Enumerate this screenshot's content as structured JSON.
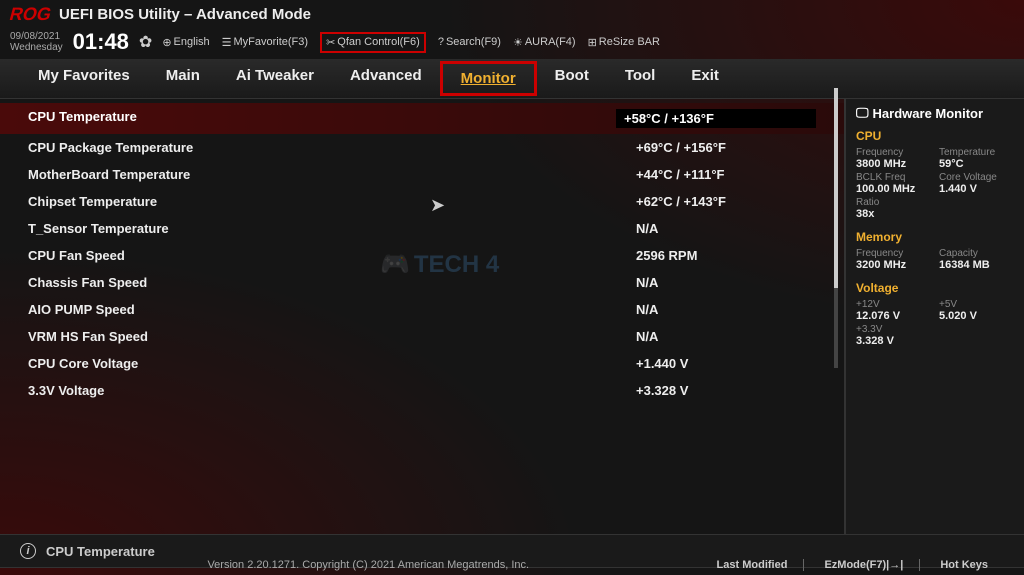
{
  "header": {
    "logo": "ROG",
    "title": "UEFI BIOS Utility – Advanced Mode"
  },
  "datetime": {
    "date": "09/08/2021",
    "day": "Wednesday",
    "time": "01:48"
  },
  "toolbar": {
    "language": "English",
    "myfavorite": "MyFavorite(F3)",
    "qfan": "Qfan Control(F6)",
    "search": "Search(F9)",
    "aura": "AURA(F4)",
    "resize": "ReSize BAR"
  },
  "tabs": [
    "My Favorites",
    "Main",
    "Ai Tweaker",
    "Advanced",
    "Monitor",
    "Boot",
    "Tool",
    "Exit"
  ],
  "settings": [
    {
      "label": "CPU Temperature",
      "value": "+58°C / +136°F",
      "selected": true
    },
    {
      "label": "CPU Package Temperature",
      "value": "+69°C / +156°F"
    },
    {
      "label": "MotherBoard Temperature",
      "value": "+44°C / +111°F"
    },
    {
      "label": "Chipset Temperature",
      "value": "+62°C / +143°F"
    },
    {
      "label": "T_Sensor Temperature",
      "value": "N/A"
    },
    {
      "label": "CPU Fan Speed",
      "value": "2596 RPM"
    },
    {
      "label": "Chassis Fan Speed",
      "value": "N/A"
    },
    {
      "label": "AIO PUMP Speed",
      "value": "N/A"
    },
    {
      "label": "VRM HS Fan Speed",
      "value": "N/A"
    },
    {
      "label": "CPU Core Voltage",
      "value": "+1.440 V"
    },
    {
      "label": "3.3V Voltage",
      "value": "+3.328 V"
    }
  ],
  "help": {
    "text": "CPU Temperature"
  },
  "sidebar": {
    "title": "Hardware Monitor",
    "cpu": {
      "title": "CPU",
      "freq_label": "Frequency",
      "freq_value": "3800 MHz",
      "temp_label": "Temperature",
      "temp_value": "59°C",
      "bclk_label": "BCLK Freq",
      "bclk_value": "100.00 MHz",
      "cv_label": "Core Voltage",
      "cv_value": "1.440 V",
      "ratio_label": "Ratio",
      "ratio_value": "38x"
    },
    "memory": {
      "title": "Memory",
      "freq_label": "Frequency",
      "freq_value": "3200 MHz",
      "cap_label": "Capacity",
      "cap_value": "16384 MB"
    },
    "voltage": {
      "title": "Voltage",
      "v12_label": "+12V",
      "v12_value": "12.076 V",
      "v5_label": "+5V",
      "v5_value": "5.020 V",
      "v33_label": "+3.3V",
      "v33_value": "3.328 V"
    }
  },
  "footer": {
    "copyright": "Version 2.20.1271. Copyright (C) 2021 American Megatrends, Inc.",
    "last_modified": "Last Modified",
    "ezmode": "EzMode(F7)|→|",
    "hotkeys": "Hot Keys"
  },
  "watermark": "TECH 4"
}
